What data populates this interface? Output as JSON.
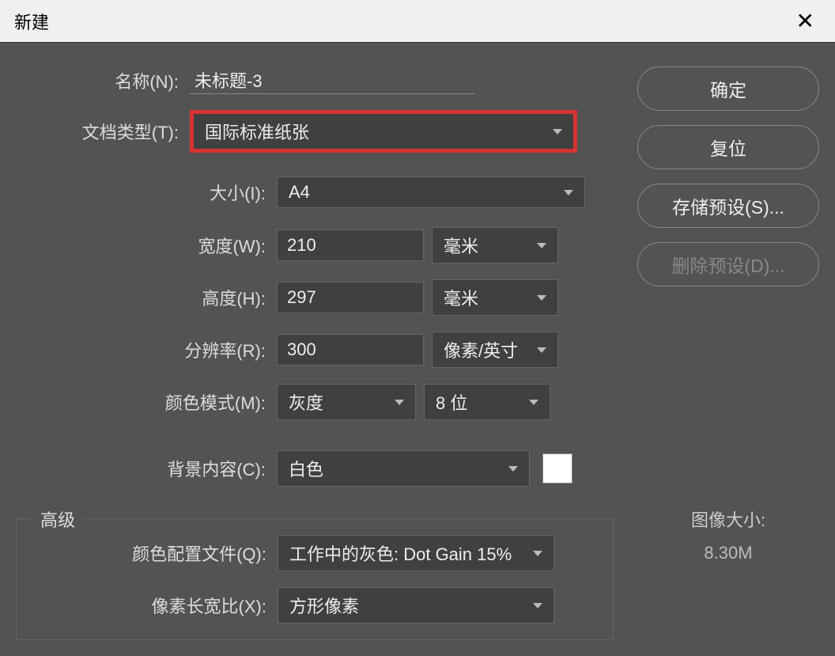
{
  "titlebar": {
    "title": "新建"
  },
  "buttons": {
    "ok": "确定",
    "reset": "复位",
    "save_preset": "存储预设(S)...",
    "delete_preset": "删除预设(D)..."
  },
  "form": {
    "name_label": "名称(N):",
    "name_value": "未标题-3",
    "doc_type_label": "文档类型(T):",
    "doc_type_value": "国际标准纸张",
    "size_label": "大小(I):",
    "size_value": "A4",
    "width_label": "宽度(W):",
    "width_value": "210",
    "width_unit": "毫米",
    "height_label": "高度(H):",
    "height_value": "297",
    "height_unit": "毫米",
    "resolution_label": "分辨率(R):",
    "resolution_value": "300",
    "resolution_unit": "像素/英寸",
    "color_mode_label": "颜色模式(M):",
    "color_mode_value": "灰度",
    "bit_depth_value": "8 位",
    "background_label": "背景内容(C):",
    "background_value": "白色"
  },
  "advanced": {
    "title": "高级",
    "color_profile_label": "颜色配置文件(Q):",
    "color_profile_value": "工作中的灰色: Dot Gain 15%",
    "pixel_aspect_label": "像素长宽比(X):",
    "pixel_aspect_value": "方形像素"
  },
  "image_size": {
    "label": "图像大小:",
    "value": "8.30M"
  }
}
